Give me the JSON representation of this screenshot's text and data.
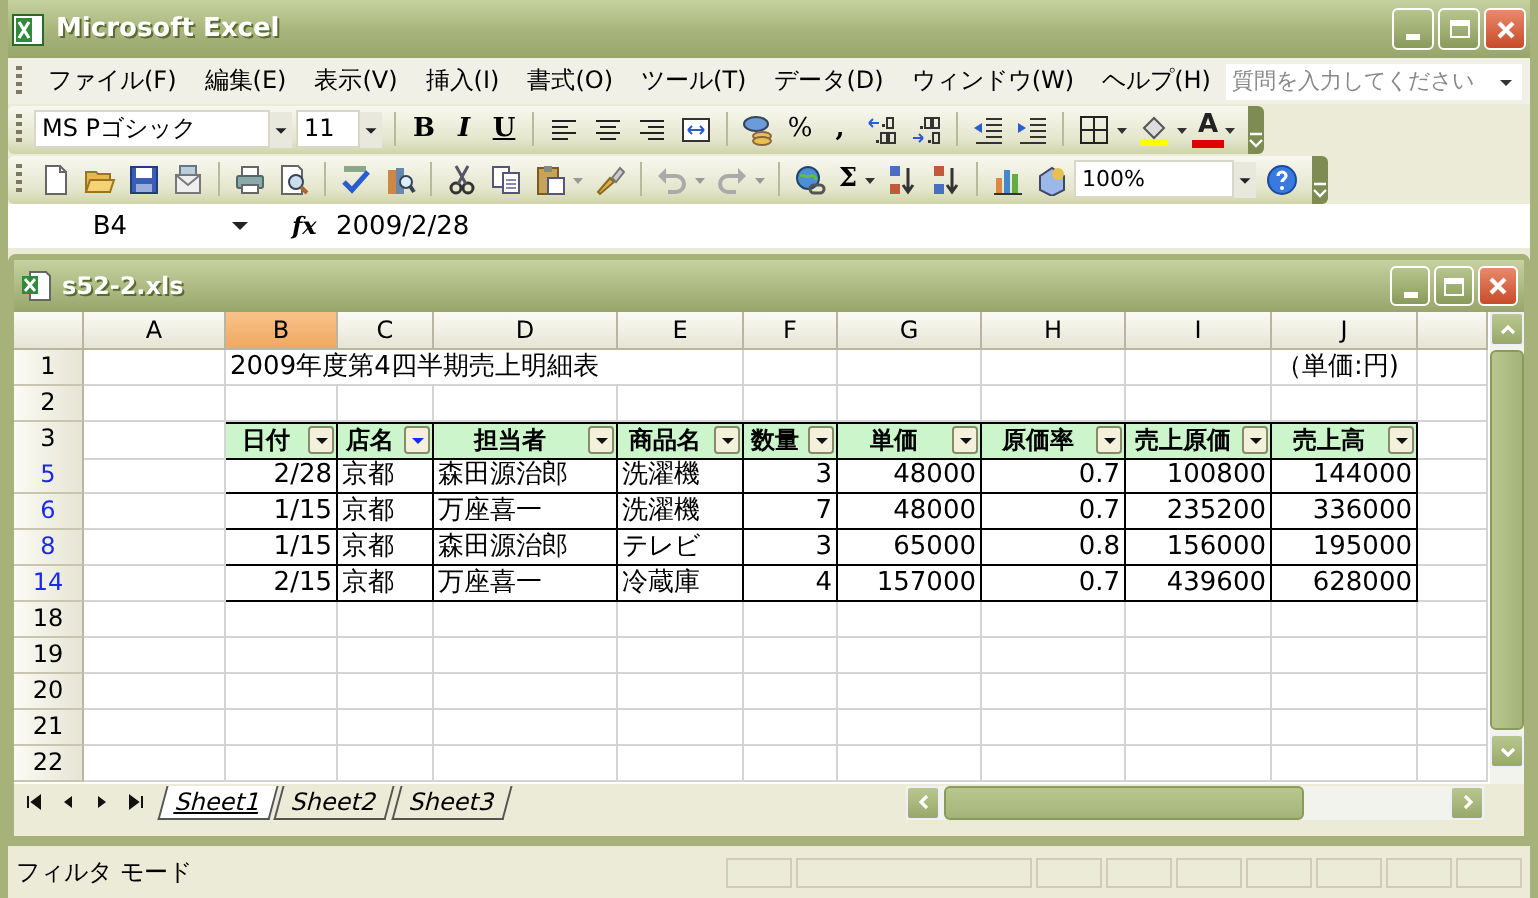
{
  "window": {
    "title": "Microsoft Excel"
  },
  "menu": [
    "ファイル(F)",
    "編集(E)",
    "表示(V)",
    "挿入(I)",
    "書式(O)",
    "ツール(T)",
    "データ(D)",
    "ウィンドウ(W)",
    "ヘルプ(H)"
  ],
  "help_box": {
    "placeholder": "質問を入力してください"
  },
  "formatting_toolbar": {
    "font": "MS Pゴシック",
    "size": "11",
    "bold": "B",
    "italic": "I",
    "underline": "U",
    "percent": "%",
    "comma": ",",
    "font_color": "A"
  },
  "standard_toolbar": {
    "autosum": "Σ",
    "zoom": "100%"
  },
  "formula_bar": {
    "name_box": "B4",
    "fx": "fx",
    "value": "2009/2/28"
  },
  "workbook": {
    "title": "s52-2.xls",
    "columns": [
      {
        "label": "A",
        "selected": false
      },
      {
        "label": "B",
        "selected": true
      },
      {
        "label": "C",
        "selected": false
      },
      {
        "label": "D",
        "selected": false
      },
      {
        "label": "E",
        "selected": false
      },
      {
        "label": "F",
        "selected": false
      },
      {
        "label": "G",
        "selected": false
      },
      {
        "label": "H",
        "selected": false
      },
      {
        "label": "I",
        "selected": false
      },
      {
        "label": "J",
        "selected": false
      }
    ],
    "rows": [
      {
        "label": "1",
        "kind": "title",
        "filtered": false,
        "title": "2009年度第4四半期売上明細表",
        "note": "（単価:円)"
      },
      {
        "label": "2",
        "kind": "blank",
        "filtered": false
      },
      {
        "label": "3",
        "kind": "header",
        "filtered": false,
        "cells": [
          {
            "text": "日付",
            "filter_active": false
          },
          {
            "text": "店名",
            "filter_active": true
          },
          {
            "text": "担当者",
            "filter_active": false
          },
          {
            "text": "商品名",
            "filter_active": false
          },
          {
            "text": "数量",
            "filter_active": false
          },
          {
            "text": "単価",
            "filter_active": false
          },
          {
            "text": "原価率",
            "filter_active": false
          },
          {
            "text": "売上原価",
            "filter_active": false
          },
          {
            "text": "売上高",
            "filter_active": false
          }
        ]
      },
      {
        "label": "5",
        "kind": "data",
        "filtered": true,
        "cells": [
          "2/28",
          "京都",
          "森田源治郎",
          "洗濯機",
          "3",
          "48000",
          "0.7",
          "100800",
          "144000"
        ]
      },
      {
        "label": "6",
        "kind": "data",
        "filtered": true,
        "cells": [
          "1/15",
          "京都",
          "万座喜一",
          "洗濯機",
          "7",
          "48000",
          "0.7",
          "235200",
          "336000"
        ]
      },
      {
        "label": "8",
        "kind": "data",
        "filtered": true,
        "cells": [
          "1/15",
          "京都",
          "森田源治郎",
          "テレビ",
          "3",
          "65000",
          "0.8",
          "156000",
          "195000"
        ]
      },
      {
        "label": "14",
        "kind": "data",
        "filtered": true,
        "cells": [
          "2/15",
          "京都",
          "万座喜一",
          "冷蔵庫",
          "4",
          "157000",
          "0.7",
          "439600",
          "628000"
        ]
      },
      {
        "label": "18",
        "kind": "blank",
        "filtered": false
      },
      {
        "label": "19",
        "kind": "blank",
        "filtered": false
      },
      {
        "label": "20",
        "kind": "blank",
        "filtered": false
      },
      {
        "label": "21",
        "kind": "blank",
        "filtered": false
      },
      {
        "label": "22",
        "kind": "blank",
        "filtered": false
      }
    ],
    "sheet_tabs": [
      {
        "label": "Sheet1",
        "selected": true
      },
      {
        "label": "Sheet2",
        "selected": false
      },
      {
        "label": "Sheet3",
        "selected": false
      }
    ]
  },
  "status_bar": {
    "mode": "フィルタ モード"
  }
}
